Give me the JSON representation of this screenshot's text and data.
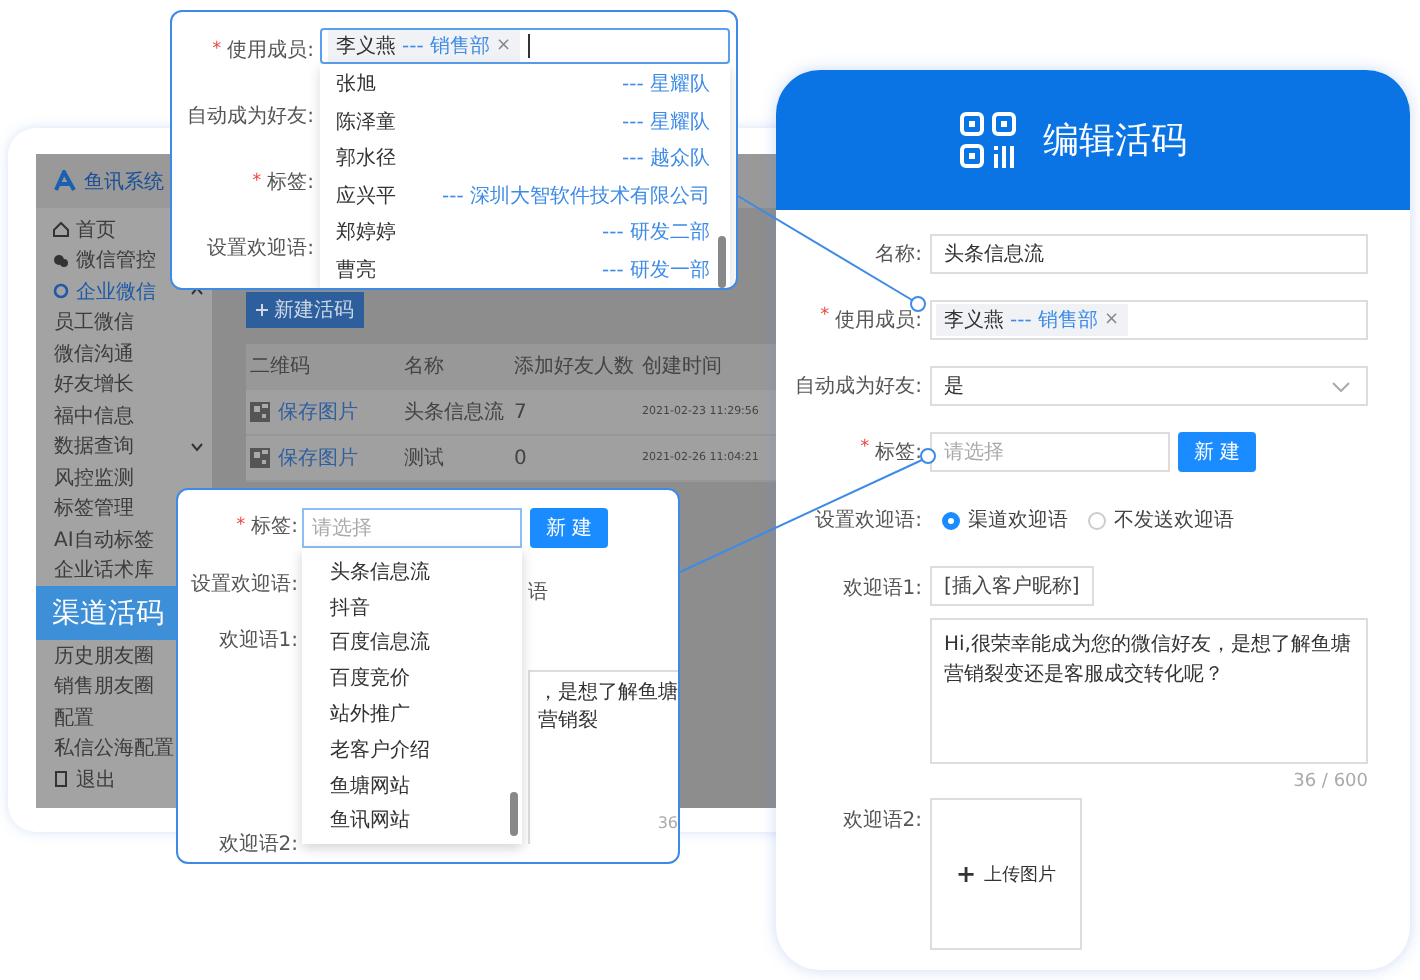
{
  "app": {
    "logo": "鱼讯系统",
    "sidebar": [
      {
        "label": "首页",
        "kind": "home",
        "selected": false
      },
      {
        "label": "微信管控",
        "kind": "chat",
        "selected": false
      },
      {
        "label": "企业微信",
        "kind": "group",
        "selected": false,
        "expanded": true
      },
      {
        "label": "员工微信",
        "kind": "sub",
        "selected": false
      },
      {
        "label": "微信沟通",
        "kind": "sub",
        "selected": false
      },
      {
        "label": "好友增长",
        "kind": "sub",
        "selected": false
      },
      {
        "label": "福中信息",
        "kind": "sub",
        "selected": false
      },
      {
        "label": "数据查询",
        "kind": "subgroup",
        "selected": false,
        "expanded": false
      },
      {
        "label": "风控监测",
        "kind": "sub",
        "selected": false
      },
      {
        "label": "标签管理",
        "kind": "sub",
        "selected": false
      },
      {
        "label": "AI自动标签",
        "kind": "sub",
        "selected": false
      },
      {
        "label": "企业话术库",
        "kind": "sub",
        "selected": false
      },
      {
        "label": "渠道活码",
        "kind": "sub",
        "selected": true
      },
      {
        "label": "历史朋友圈",
        "kind": "sub",
        "selected": false
      },
      {
        "label": "销售朋友圈",
        "kind": "sub",
        "selected": false
      },
      {
        "label": "配置",
        "kind": "sub",
        "selected": false
      },
      {
        "label": "私信公海配置",
        "kind": "sub",
        "selected": false
      },
      {
        "label": "退出",
        "kind": "exit",
        "selected": false
      }
    ],
    "new_button": "新建活码",
    "table": {
      "columns": [
        "二维码",
        "名称",
        "添加好友人数",
        "创建时间"
      ],
      "rows": [
        {
          "action": "保存图片",
          "name": "头条信息流",
          "friends": "7",
          "created": "2021-02-23 11:29:56"
        },
        {
          "action": "保存图片",
          "name": "测试",
          "friends": "0",
          "created": "2021-02-26 11:04:21"
        }
      ]
    }
  },
  "member_popup": {
    "labels": [
      {
        "text": "使用成员:",
        "marker": "*"
      },
      {
        "text": "自动成为好友:"
      },
      {
        "text": "标签:",
        "marker": "*"
      },
      {
        "text": "设置欢迎语:"
      }
    ],
    "tag": {
      "name": "李义燕",
      "dept": "--- 销售部",
      "remove": "×"
    },
    "options": [
      {
        "name": "张旭",
        "dept": "--- 星耀队"
      },
      {
        "name": "陈泽童",
        "dept": "--- 星耀队"
      },
      {
        "name": "郭水径",
        "dept": "--- 越众队"
      },
      {
        "name": "应兴平",
        "dept": "--- 深圳大智软件技术有限公司"
      },
      {
        "name": "郑婷婷",
        "dept": "--- 研发二部"
      },
      {
        "name": "曹亮",
        "dept": "--- 研发一部"
      }
    ]
  },
  "tag_popup": {
    "labels": [
      {
        "text": "标签:",
        "marker": "*"
      },
      {
        "text": "设置欢迎语:"
      },
      {
        "text": "欢迎语1:"
      },
      {
        "text": "欢迎语2:"
      }
    ],
    "placeholder": "请选择",
    "new_button": "新 建",
    "options": [
      "头条信息流",
      "抖音",
      "百度信息流",
      "百度竞价",
      "站外推广",
      "老客户介绍",
      "鱼塘网站",
      "鱼讯网站"
    ],
    "partial_option": "语",
    "partial_message": "，是想了解鱼塘营销裂",
    "partial_count": "36"
  },
  "edit_panel": {
    "title": "编辑活码",
    "fields": [
      {
        "kind": "input",
        "label": "名称:",
        "value": "头条信息流"
      },
      {
        "kind": "members",
        "label": "使用成员:",
        "marker": "*",
        "tag": "李义燕",
        "dept": "--- 销售部",
        "remove": "×"
      },
      {
        "kind": "select",
        "label": "自动成为好友:",
        "value": "是"
      },
      {
        "kind": "tags",
        "label": "标签:",
        "marker": "*",
        "placeholder": "请选择",
        "button": "新 建"
      },
      {
        "kind": "radio",
        "label": "设置欢迎语:",
        "options": [
          {
            "label": "渠道欢迎语",
            "selected": true
          },
          {
            "label": "不发送欢迎语",
            "selected": false
          }
        ]
      },
      {
        "kind": "message",
        "label": "欢迎语1:",
        "insert": "[插入客户昵称]",
        "text": "Hi,很荣幸能成为您的微信好友，是想了解鱼塘营销裂变还是客服成交转化呢？",
        "count": "36 / 600"
      },
      {
        "kind": "upload",
        "label": "欢迎语2:",
        "plus": "+",
        "button": "上传图片"
      }
    ]
  }
}
